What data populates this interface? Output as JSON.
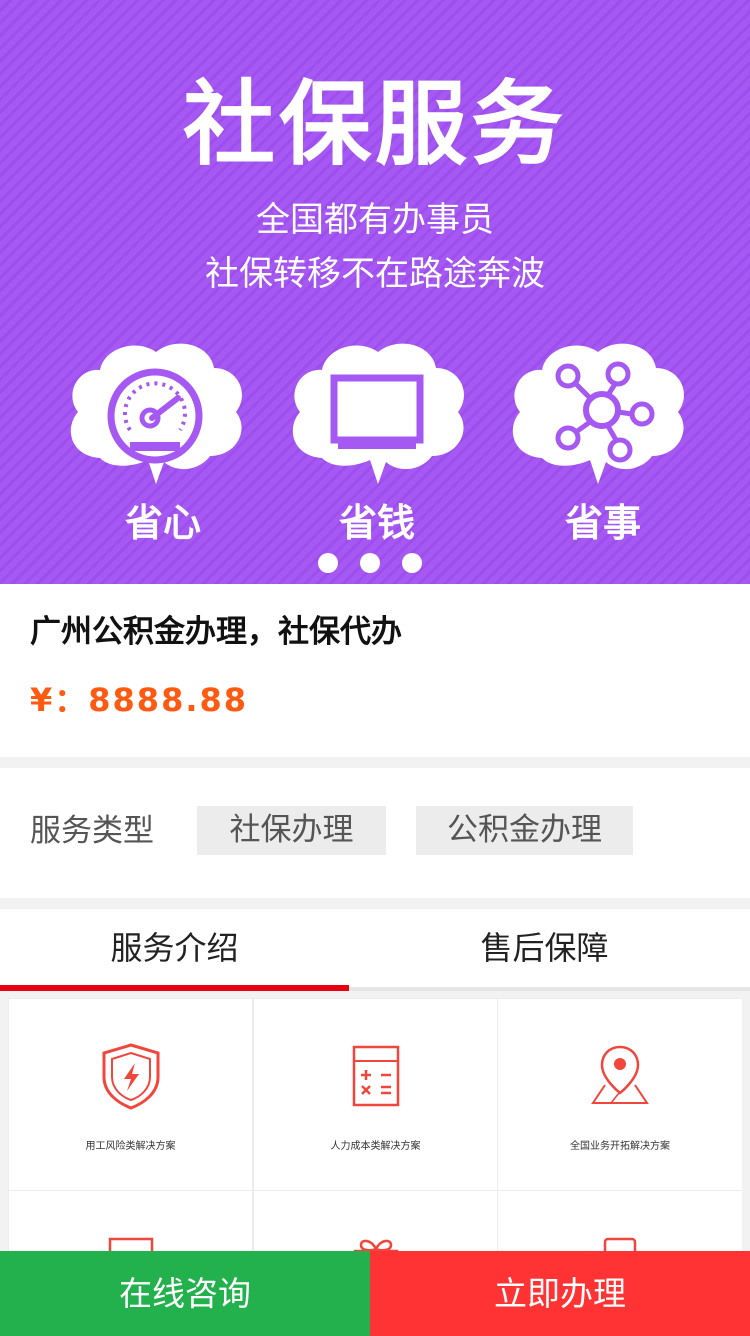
{
  "banner": {
    "title": "社保服务",
    "subtitle_line1": "全国都有办事员",
    "subtitle_line2": "社保转移不在路途奔波",
    "features": [
      {
        "label": "省心",
        "icon": "speedometer-icon"
      },
      {
        "label": "省钱",
        "icon": "monitor-icon"
      },
      {
        "label": "省事",
        "icon": "network-icon"
      }
    ],
    "carousel_dots": 3
  },
  "product": {
    "title": "广州公积金办理，社保代办",
    "price": "¥：8888.88"
  },
  "service_type": {
    "label": "服务类型",
    "options": [
      "社保办理",
      "公积金办理"
    ]
  },
  "tabs": [
    {
      "label": "服务介绍",
      "active": true
    },
    {
      "label": "售后保障",
      "active": false
    }
  ],
  "solutions": [
    {
      "caption": "用工风险类解决方案",
      "icon": "shield-lightning-icon"
    },
    {
      "caption": "人力成本类解决方案",
      "icon": "calculator-icon"
    },
    {
      "caption": "全国业务开拓解决方案",
      "icon": "map-pin-icon"
    },
    {
      "caption": "",
      "icon": "document-icon"
    },
    {
      "caption": "",
      "icon": "gift-icon"
    },
    {
      "caption": "",
      "icon": "phone-icon"
    }
  ],
  "actions": {
    "consult": "在线咨询",
    "apply": "立即办理"
  },
  "colors": {
    "banner_purple": "#a558f2",
    "price_orange": "#ff5a12",
    "tab_active_red": "#e60012",
    "consult_green": "#22b14c",
    "apply_red": "#ff3333",
    "icon_red": "#f0463c"
  }
}
